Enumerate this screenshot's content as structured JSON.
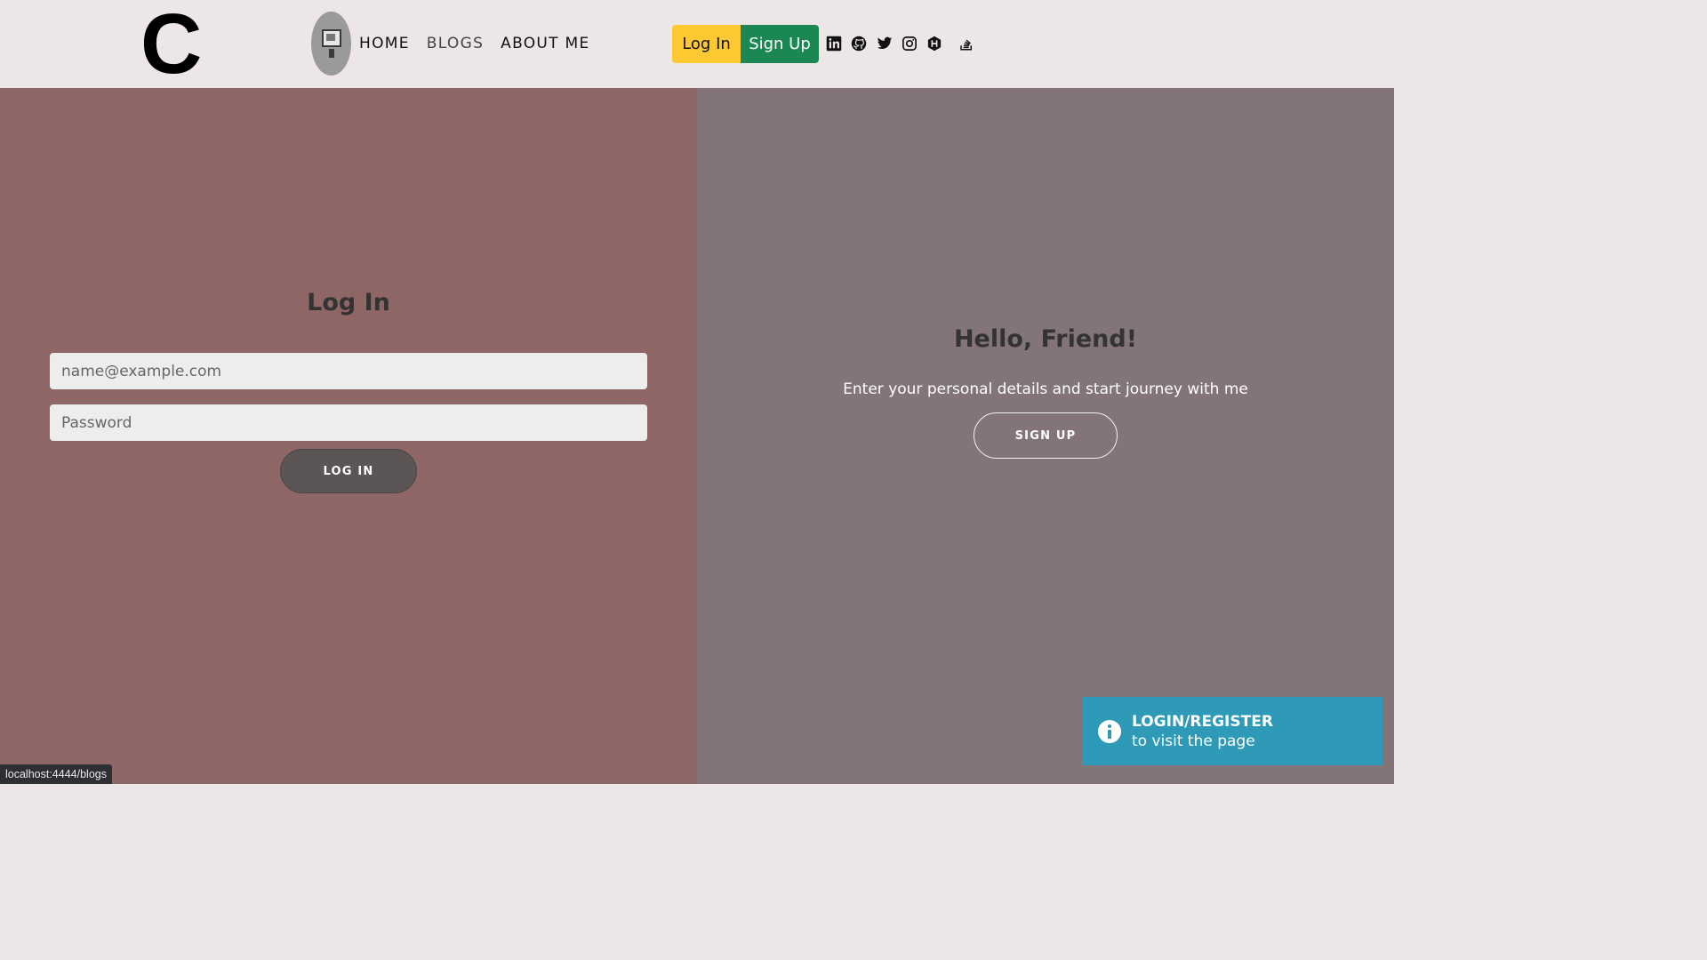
{
  "brand": {
    "logo_text": "C"
  },
  "nav": {
    "home": "HOME",
    "blogs": "BLOGS",
    "about": "ABOUT ME"
  },
  "auth": {
    "login_label": "Log In",
    "signup_label": "Sign Up",
    "login_color": "#fcc932",
    "signup_color": "#1b8753"
  },
  "social_icons": [
    "linkedin-icon",
    "github-icon",
    "twitter-icon",
    "instagram-icon",
    "hashnode-icon",
    "stackoverflow-icon"
  ],
  "login_panel": {
    "title": "Log In",
    "email_placeholder": "name@example.com",
    "password_placeholder": "Password",
    "submit_label": "LOG IN",
    "background": "#8f6666"
  },
  "signup_panel": {
    "title": "Hello, Friend!",
    "subtitle": "Enter your personal details and start journey with me",
    "button_label": "SIGN UP",
    "background": "#837477"
  },
  "toast": {
    "icon": "info-icon",
    "title": "LOGIN/REGISTER",
    "body": "to visit the page",
    "background": "#2e9ab8"
  },
  "status_bar": {
    "url": "localhost:4444/blogs"
  }
}
